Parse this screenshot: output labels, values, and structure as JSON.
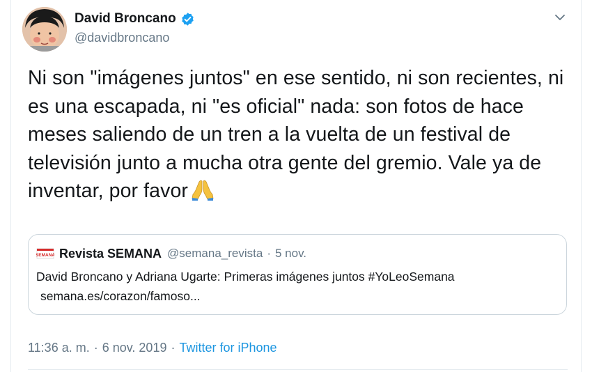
{
  "author": {
    "name": "David Broncano",
    "handle": "@davidbroncano"
  },
  "tweet": {
    "text": "Ni son \"imágenes juntos\" en ese sentido, ni son recientes, ni es una escapada, ni \"es oficial\" nada: son fotos de hace meses saliendo de un tren a la vuelta de un festival de televisión junto a mucha otra gente del gremio. Vale ya de inventar, por favor",
    "emoji": "folded-hands"
  },
  "quote": {
    "name": "Revista SEMANA",
    "handle": "@semana_revista",
    "separator": "·",
    "date": "5 nov.",
    "text": "David Broncano y Adriana Ugarte: Primeras imágenes juntos #YoLeoSemana",
    "link": "semana.es/corazon/famoso..."
  },
  "meta": {
    "time": "11:36 a. m.",
    "separator": "·",
    "date": "6 nov. 2019",
    "separator2": "·",
    "source": "Twitter for iPhone"
  },
  "colors": {
    "text": "#14171a",
    "secondary": "#657786",
    "accent": "#1b95e0",
    "verified": "#1da1f2",
    "border": "#ccd6dd"
  },
  "icons": [
    "avatar",
    "verified-icon",
    "chevron-down-icon",
    "folded-hands-emoji",
    "semana-logo-icon"
  ]
}
